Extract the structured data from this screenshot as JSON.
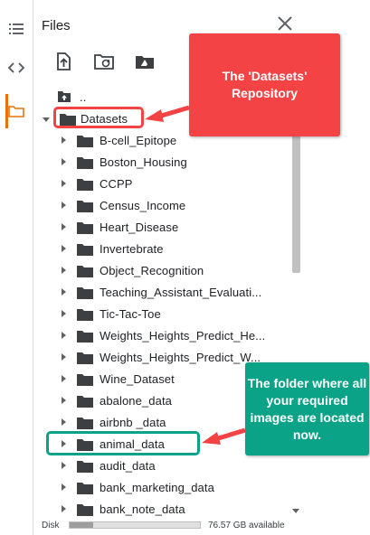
{
  "panel": {
    "title": "Files"
  },
  "rail": {
    "icons": [
      "list-icon",
      "code-icon",
      "folder-icon"
    ],
    "accent": "#e8710a"
  },
  "toolbar": {
    "buttons": [
      "upload-icon",
      "refresh-folder-icon",
      "drive-icon"
    ]
  },
  "tree": {
    "parent": "..",
    "root": "Datasets",
    "items": [
      "B-cell_Epitope",
      "Boston_Housing",
      "CCPP",
      "Census_Income",
      "Heart_Disease",
      "Invertebrate",
      "Object_Recognition",
      "Teaching_Assistant_Evaluati...",
      "Tic-Tac-Toe",
      "Weights_Heights_Predict_He...",
      "Weights_Heights_Predict_W...",
      "Wine_Dataset",
      "abalone_data",
      "airbnb _data",
      "animal_data",
      "audit_data",
      "bank_marketing_data",
      "bank_note_data"
    ]
  },
  "footer": {
    "disk_label": "Disk",
    "disk_used_fraction": 0.18,
    "available": "76.57 GB available"
  },
  "annotations": {
    "red": {
      "text": "The 'Datasets' Repository",
      "color": "#f44345"
    },
    "green": {
      "text": "The folder where all your required images are located now.",
      "color": "#0aa387"
    }
  }
}
